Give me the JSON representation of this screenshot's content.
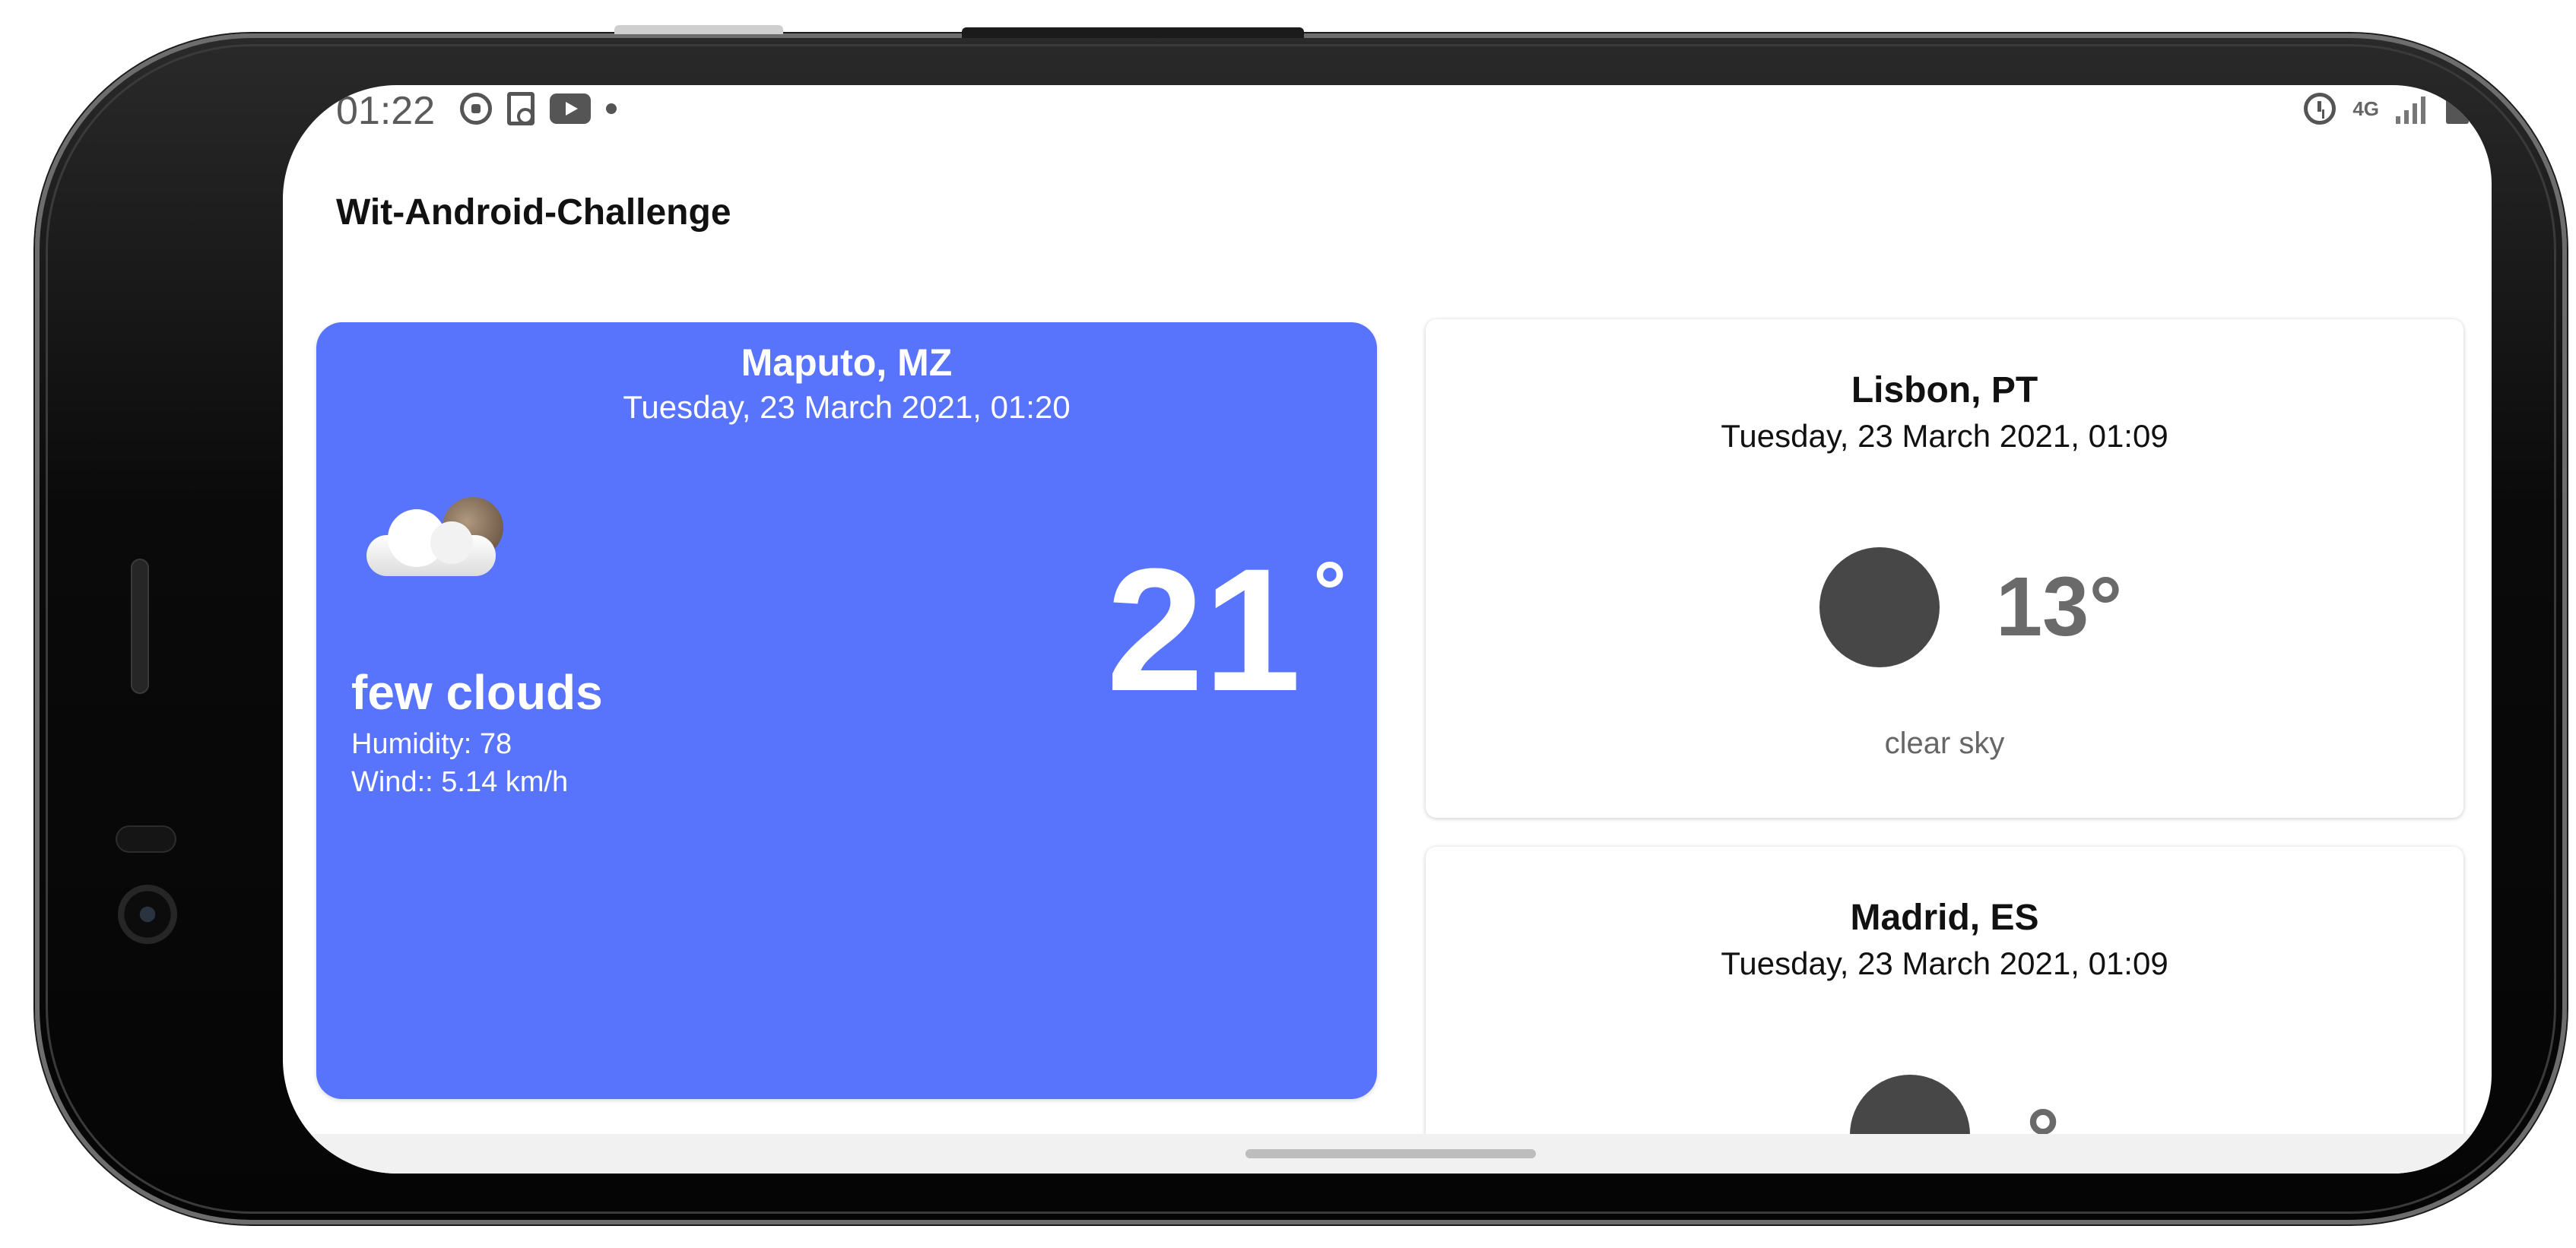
{
  "status_bar": {
    "time": "01:22",
    "network": "4G",
    "left_icons": [
      "whatsapp-icon",
      "document-search-icon",
      "youtube-icon",
      "dot-icon"
    ],
    "right_icons": [
      "alarm-icon",
      "network-4g-icon",
      "signal-icon",
      "battery-icon"
    ]
  },
  "app": {
    "title": "Wit-Android-Challenge"
  },
  "main_card": {
    "city": "Maputo, MZ",
    "date": "Tuesday, 23 March 2021, 01:20",
    "temperature": "21",
    "degree": "°",
    "description": "few clouds",
    "humidity": "Humidity: 78",
    "wind": "Wind:: 5.14 km/h",
    "icon": "few-clouds-night-icon",
    "color": "#5874fc"
  },
  "cities": [
    {
      "city": "Lisbon, PT",
      "date": "Tuesday, 23 March 2021, 01:09",
      "temperature": "13°",
      "description": "clear sky",
      "icon": "moon-icon"
    },
    {
      "city": "Madrid, ES",
      "date": "Tuesday, 23 March 2021, 01:09",
      "temperature": "°",
      "icon": "moon-icon"
    }
  ]
}
